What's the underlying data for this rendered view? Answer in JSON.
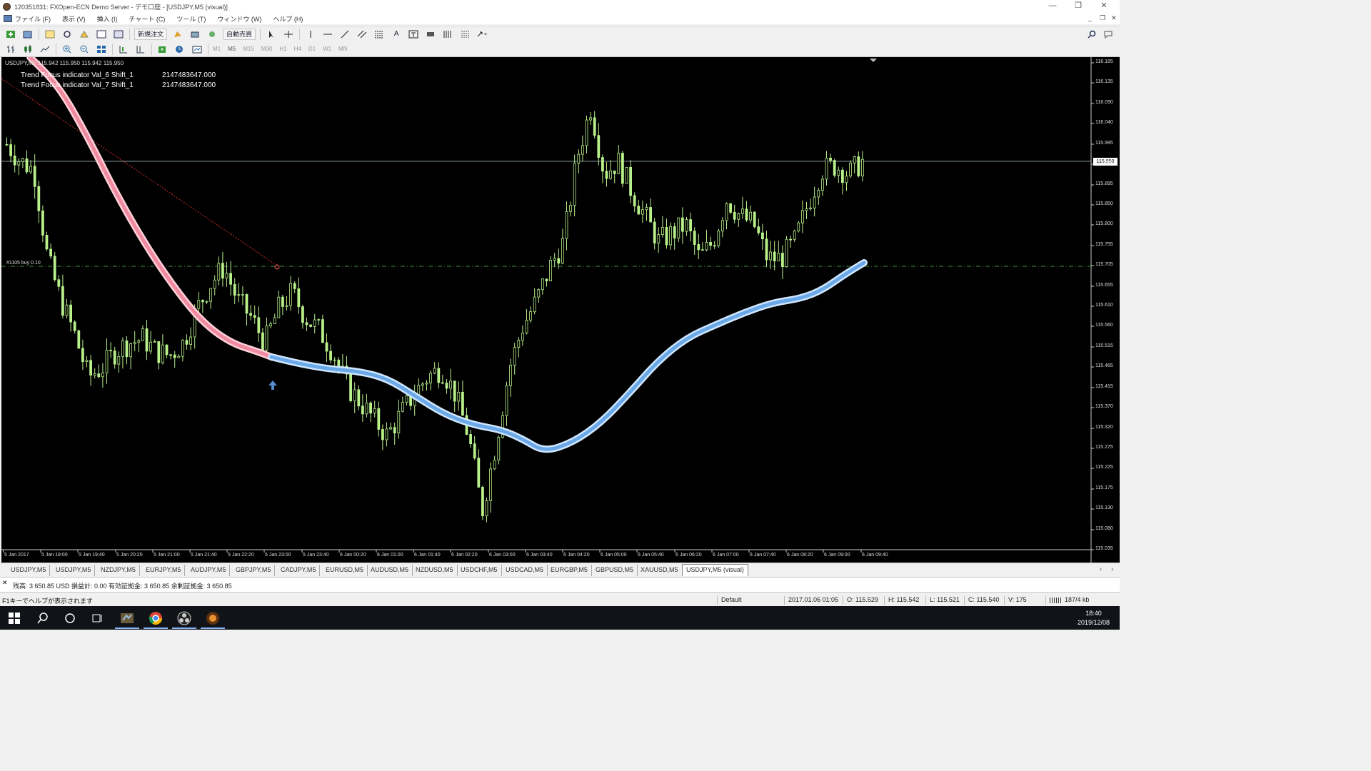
{
  "window": {
    "title": "120351831: FXOpen-ECN Demo Server - デモ口座 - [USDJPY,M5 (visual)]",
    "controls": [
      "—",
      "❐",
      "✕"
    ],
    "mdi_controls": [
      "_",
      "❐",
      "✕"
    ]
  },
  "menu": [
    "ファイル (F)",
    "表示 (V)",
    "挿入 (I)",
    "チャート (C)",
    "ツール (T)",
    "ウィンドウ (W)",
    "ヘルプ (H)"
  ],
  "toolbar": {
    "new_order": "新規注文",
    "auto_trade": "自動売買"
  },
  "timeframes": [
    "M1",
    "M5",
    "M15",
    "M30",
    "H1",
    "H4",
    "D1",
    "W1",
    "MN"
  ],
  "chart": {
    "symbol_info": "USDJPY,M5  115.942 115.950 115.942 115.950",
    "indicators": [
      {
        "label": "Trend Focus indicator  Val_6  Shift_1",
        "value": "2147483647.000"
      },
      {
        "label": "Trend Focus indicator  Val_7  Shift_1",
        "value": "2147483647.000"
      }
    ],
    "order_label": "#1105 buy 0.10",
    "current_price": "115.950",
    "colors": {
      "bg": "#000000",
      "candle": "#b8f08a",
      "trend_down": "#f08aa0",
      "trend_up": "#6aa8e8",
      "order_line": "#3b8f3b",
      "price_line": "#9fb0b8"
    }
  },
  "chart_data": {
    "type": "candlestick",
    "y_ticks": [
      "116.185",
      "116.135",
      "116.090",
      "116.040",
      "115.995",
      "115.950",
      "115.895",
      "115.850",
      "115.800",
      "115.755",
      "115.705",
      "115.655",
      "115.610",
      "115.560",
      "115.515",
      "115.465",
      "115.415",
      "115.370",
      "115.320",
      "115.275",
      "115.225",
      "115.175",
      "115.130",
      "115.080",
      "115.035"
    ],
    "x_ticks": [
      "5 Jan 2017",
      "5 Jan 19:00",
      "5 Jan 19:40",
      "5 Jan 20:20",
      "5 Jan 21:00",
      "5 Jan 21:40",
      "5 Jan 22:20",
      "5 Jan 23:00",
      "5 Jan 23:40",
      "6 Jan 00:20",
      "6 Jan 01:00",
      "6 Jan 01:40",
      "6 Jan 02:20",
      "6 Jan 03:00",
      "6 Jan 03:40",
      "6 Jan 04:20",
      "6 Jan 05:00",
      "6 Jan 05:40",
      "6 Jan 06:20",
      "6 Jan 07:00",
      "6 Jan 07:40",
      "6 Jan 08:20",
      "6 Jan 09:00",
      "6 Jan 09:40"
    ],
    "ylim": [
      115.03,
      116.19
    ],
    "close_path": [
      115.99,
      115.95,
      115.93,
      115.72,
      115.62,
      115.54,
      115.44,
      115.46,
      115.5,
      115.52,
      115.53,
      115.5,
      115.49,
      115.52,
      115.6,
      115.66,
      115.7,
      115.62,
      115.58,
      115.52,
      115.6,
      115.64,
      115.58,
      115.55,
      115.5,
      115.42,
      115.38,
      115.34,
      115.3,
      115.35,
      115.4,
      115.44,
      115.46,
      115.4,
      115.3,
      115.12,
      115.28,
      115.46,
      115.56,
      115.62,
      115.7,
      115.76,
      115.96,
      116.08,
      115.92,
      115.95,
      115.88,
      115.82,
      115.76,
      115.78,
      115.8,
      115.72,
      115.76,
      115.86,
      115.82,
      115.8,
      115.72,
      115.72,
      115.76,
      115.85,
      115.93,
      115.94,
      115.92,
      115.95
    ],
    "series": [
      {
        "name": "Trend Focus indicator"
      }
    ]
  },
  "tabs": [
    "USDJPY,M5",
    "USDJPY,M5",
    "NZDJPY,M5",
    "EURJPY,M5",
    "AUDJPY,M5",
    "GBPJPY,M5",
    "CADJPY,M5",
    "EURUSD,M5",
    "AUDUSD,M5",
    "NZDUSD,M5",
    "USDCHF,M5",
    "USDCAD,M5",
    "EURGBP,M5",
    "GBPUSD,M5",
    "XAUUSD,M5",
    "USDJPY,M5 (visual)"
  ],
  "account": "残高: 3 650.85 USD  損益計: 0.00  有効証拠金: 3 650.85  余剰証拠金: 3 650.85",
  "status": {
    "help": "F1キーでヘルプが表示されます",
    "profile": "Default",
    "datetime": "2017.01.06 01:05",
    "open": "O: 115.529",
    "high": "H: 115.542",
    "low": "L: 115.521",
    "close": "C: 115.540",
    "volume": "V: 175",
    "traffic": "187/4 kb"
  },
  "taskbar": {
    "time": "18:40",
    "date": "2019/12/08"
  }
}
